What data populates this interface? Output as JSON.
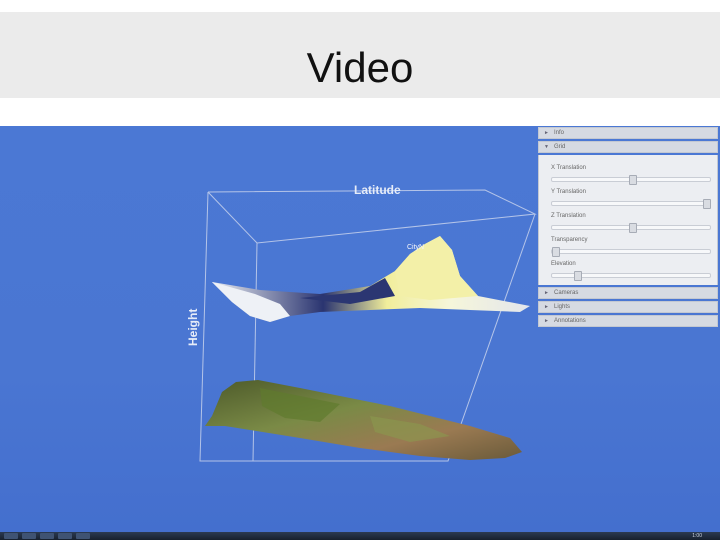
{
  "slide": {
    "title": "Video"
  },
  "viewer": {
    "axis_labels": {
      "latitude": "Latitude",
      "height": "Height"
    },
    "city_label": "CityN"
  },
  "panel": {
    "sections": [
      {
        "label": "Info",
        "expanded": false
      },
      {
        "label": "Grid",
        "expanded": true
      },
      {
        "label": "Cameras",
        "expanded": false
      },
      {
        "label": "Lights",
        "expanded": false
      },
      {
        "label": "Annotations",
        "expanded": false
      }
    ],
    "controls": [
      {
        "label": "X Translation",
        "value": 0.5
      },
      {
        "label": "Y Translation",
        "value": 1.0
      },
      {
        "label": "Z Translation",
        "value": 0.5
      },
      {
        "label": "Transparency",
        "value": 0.0
      },
      {
        "label": "Elevation",
        "value": 0.15
      }
    ]
  },
  "taskbar": {
    "clock": "1:00"
  },
  "colors": {
    "background": "#4a76d2",
    "accent": "#f2ef9a"
  }
}
